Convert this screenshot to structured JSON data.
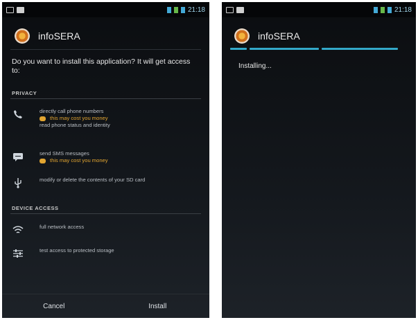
{
  "left_screen": {
    "app_name": "infoSERA",
    "question": "Do you want to install this application? It will get access to:",
    "sections": [
      {
        "title": "PRIVACY",
        "items": [
          {
            "icon": "phone-icon",
            "lines": [
              "directly call phone numbers"
            ],
            "cost": "this may cost you money",
            "after": "read phone status and identity"
          },
          {
            "icon": "sms-icon",
            "lines": [
              "send SMS messages"
            ],
            "cost": "this may cost you money",
            "after": ""
          },
          {
            "icon": "usb-icon",
            "lines": [
              "modify or delete the contents of your SD card"
            ],
            "cost": "",
            "after": ""
          }
        ]
      },
      {
        "title": "DEVICE ACCESS",
        "items": [
          {
            "icon": "wifi-icon",
            "lines": [
              "full network access"
            ],
            "cost": "",
            "after": ""
          },
          {
            "icon": "settings-sliders-icon",
            "lines": [
              "test access to protected storage"
            ],
            "cost": "",
            "after": ""
          }
        ]
      }
    ],
    "buttons": {
      "cancel": "Cancel",
      "install": "Install"
    },
    "status_time": "21:18"
  },
  "right_screen": {
    "app_name": "infoSERA",
    "status": "Installing...",
    "status_time": "21:18"
  },
  "colors": {
    "accent": "#33a9c9",
    "warning": "#e2a531",
    "background": "#101317"
  }
}
